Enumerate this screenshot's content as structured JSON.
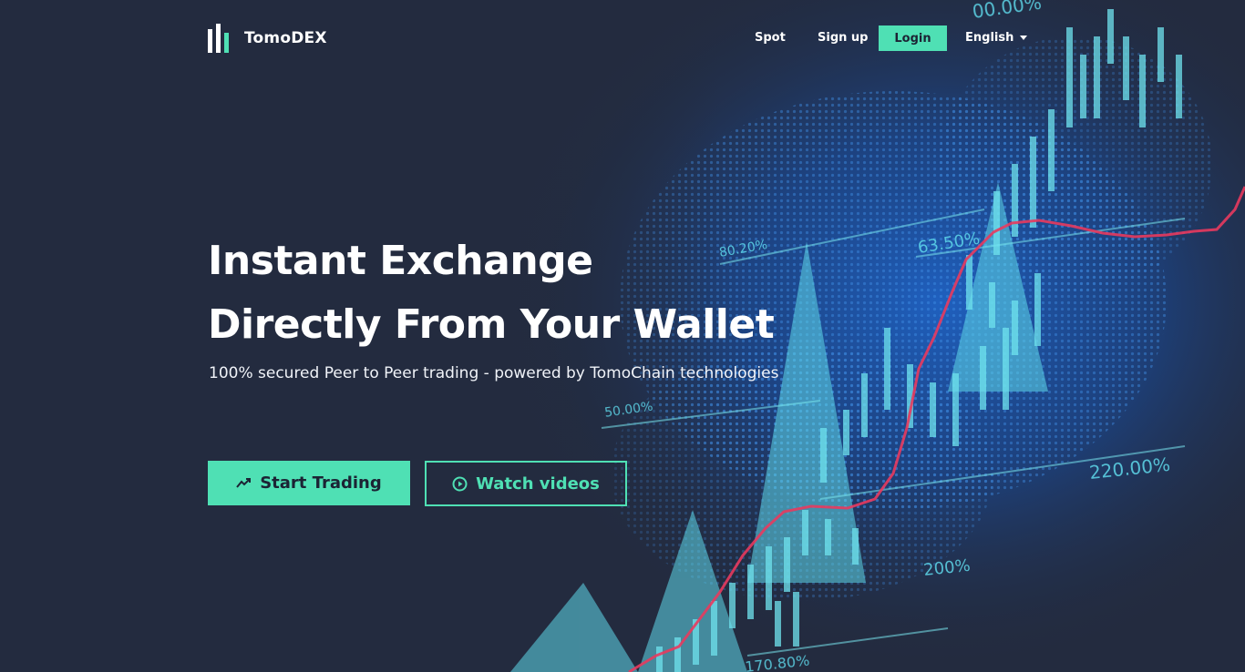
{
  "brand": {
    "name": "TomoDEX",
    "accent": "#4fe0b4",
    "background": "#232b3f",
    "trend_line": "#e83a5e"
  },
  "nav": {
    "spot": "Spot",
    "signup": "Sign up",
    "login": "Login",
    "language": "English"
  },
  "hero": {
    "headline_line1": "Instant Exchange",
    "headline_line2": "Directly From Your Wallet",
    "subheadline": "100% secured Peer to Peer trading - powered by TomoChain technologies",
    "start_trading": "Start Trading",
    "watch_videos": "Watch videos"
  },
  "background_labels": [
    "00.00%",
    "80.20%",
    "63.50%",
    "50.00%",
    "220.00%",
    "200%",
    "170.80%"
  ],
  "icons": [
    "tomodex-logo-icon",
    "chevron-down-icon",
    "trending-icon",
    "play-circle-icon"
  ]
}
